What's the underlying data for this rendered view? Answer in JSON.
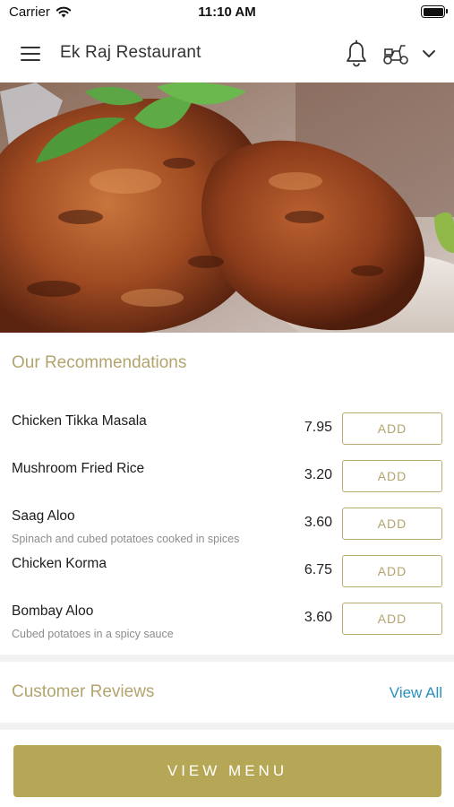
{
  "status_bar": {
    "carrier": "Carrier",
    "time": "11:10 AM",
    "wifi_icon": "wifi-icon",
    "battery_icon": "battery-icon"
  },
  "header": {
    "title": "Ek Raj Restaurant",
    "menu_icon": "hamburger-menu-icon",
    "notification_icon": "bell-icon",
    "delivery_icon": "scooter-icon",
    "dropdown_icon": "chevron-down-icon"
  },
  "hero": {
    "image": "tandoori-chicken-photo"
  },
  "recommendations": {
    "title": "Our Recommendations",
    "add_label": "ADD",
    "items": [
      {
        "name": "Chicken Tikka Masala",
        "description": "",
        "price": "7.95"
      },
      {
        "name": "Mushroom Fried Rice",
        "description": "",
        "price": "3.20"
      },
      {
        "name": "Saag Aloo",
        "description": "Spinach and cubed potatoes cooked in spices",
        "price": "3.60"
      },
      {
        "name": "Chicken Korma",
        "description": "",
        "price": "6.75"
      },
      {
        "name": "Bombay Aloo",
        "description": "Cubed potatoes in a spicy sauce",
        "price": "3.60"
      }
    ]
  },
  "reviews": {
    "title": "Customer Reviews",
    "view_all_label": "View All"
  },
  "footer": {
    "view_menu_label": "VIEW MENU"
  },
  "colors": {
    "accent_gold": "#b6a757",
    "heading_gold": "#b3a46e",
    "link_blue": "#2a8fbd",
    "divider_gray": "#f2f2f2"
  }
}
